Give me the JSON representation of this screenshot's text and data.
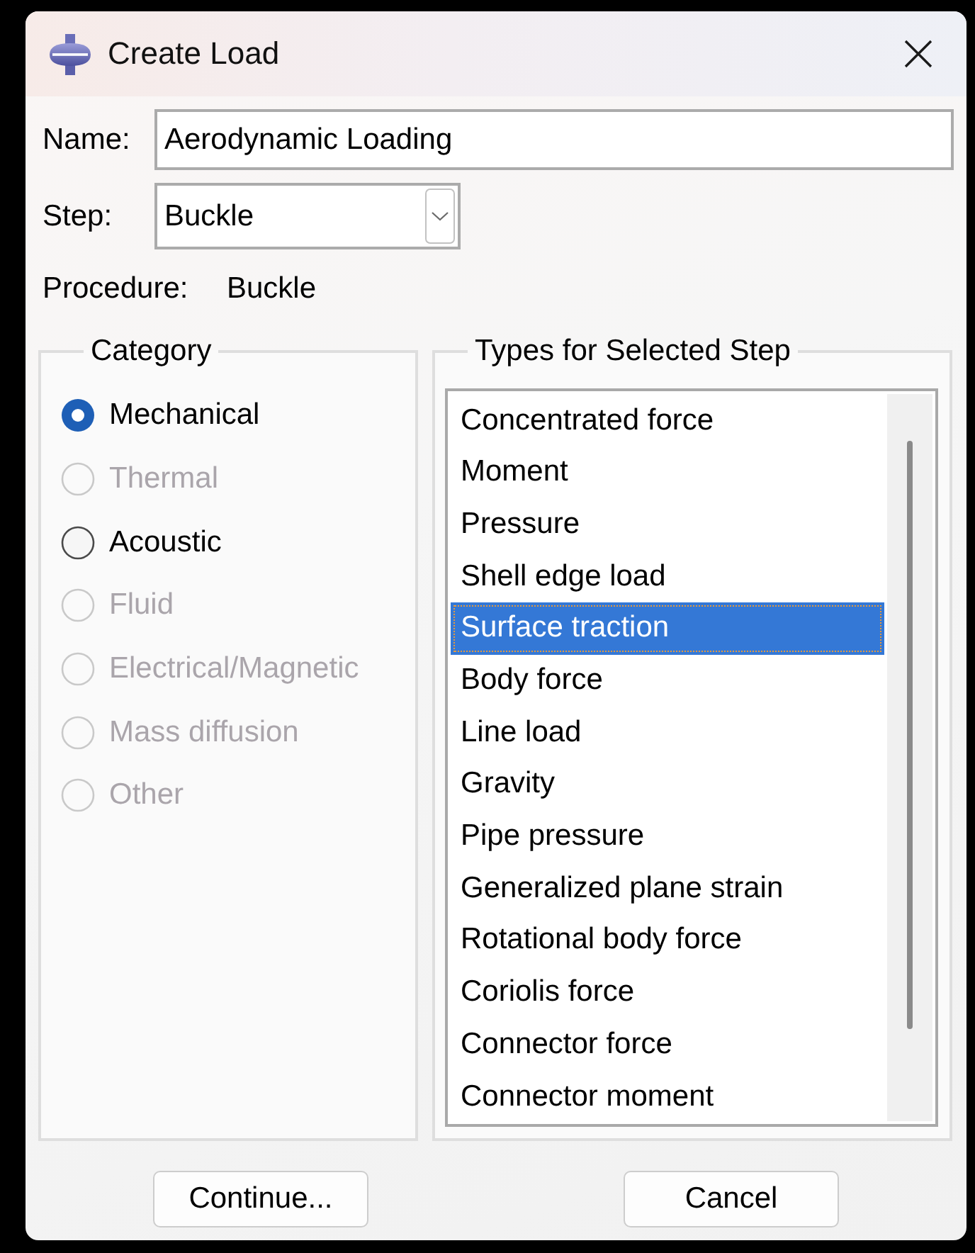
{
  "window": {
    "title": "Create Load"
  },
  "name": {
    "label": "Name:",
    "value": "Aerodynamic Loading"
  },
  "step": {
    "label": "Step:",
    "value": "Buckle"
  },
  "procedure": {
    "label": "Procedure:",
    "value": "Buckle"
  },
  "category": {
    "title": "Category",
    "options": [
      {
        "label": "Mechanical",
        "selected": true,
        "disabled": false
      },
      {
        "label": "Thermal",
        "selected": false,
        "disabled": true
      },
      {
        "label": "Acoustic",
        "selected": false,
        "disabled": false
      },
      {
        "label": "Fluid",
        "selected": false,
        "disabled": true
      },
      {
        "label": "Electrical/Magnetic",
        "selected": false,
        "disabled": true
      },
      {
        "label": "Mass diffusion",
        "selected": false,
        "disabled": true
      },
      {
        "label": "Other",
        "selected": false,
        "disabled": true
      }
    ]
  },
  "types": {
    "title": "Types for Selected Step",
    "items": [
      {
        "label": "Concentrated force",
        "selected": false
      },
      {
        "label": "Moment",
        "selected": false
      },
      {
        "label": "Pressure",
        "selected": false
      },
      {
        "label": "Shell edge load",
        "selected": false
      },
      {
        "label": "Surface traction",
        "selected": true
      },
      {
        "label": "Body force",
        "selected": false
      },
      {
        "label": "Line load",
        "selected": false
      },
      {
        "label": "Gravity",
        "selected": false
      },
      {
        "label": "Pipe pressure",
        "selected": false
      },
      {
        "label": "Generalized plane strain",
        "selected": false
      },
      {
        "label": "Rotational body force",
        "selected": false
      },
      {
        "label": "Coriolis force",
        "selected": false
      },
      {
        "label": "Connector force",
        "selected": false
      },
      {
        "label": "Connector moment",
        "selected": false
      }
    ]
  },
  "buttons": [
    {
      "label": "Continue..."
    },
    {
      "label": "Cancel"
    }
  ]
}
